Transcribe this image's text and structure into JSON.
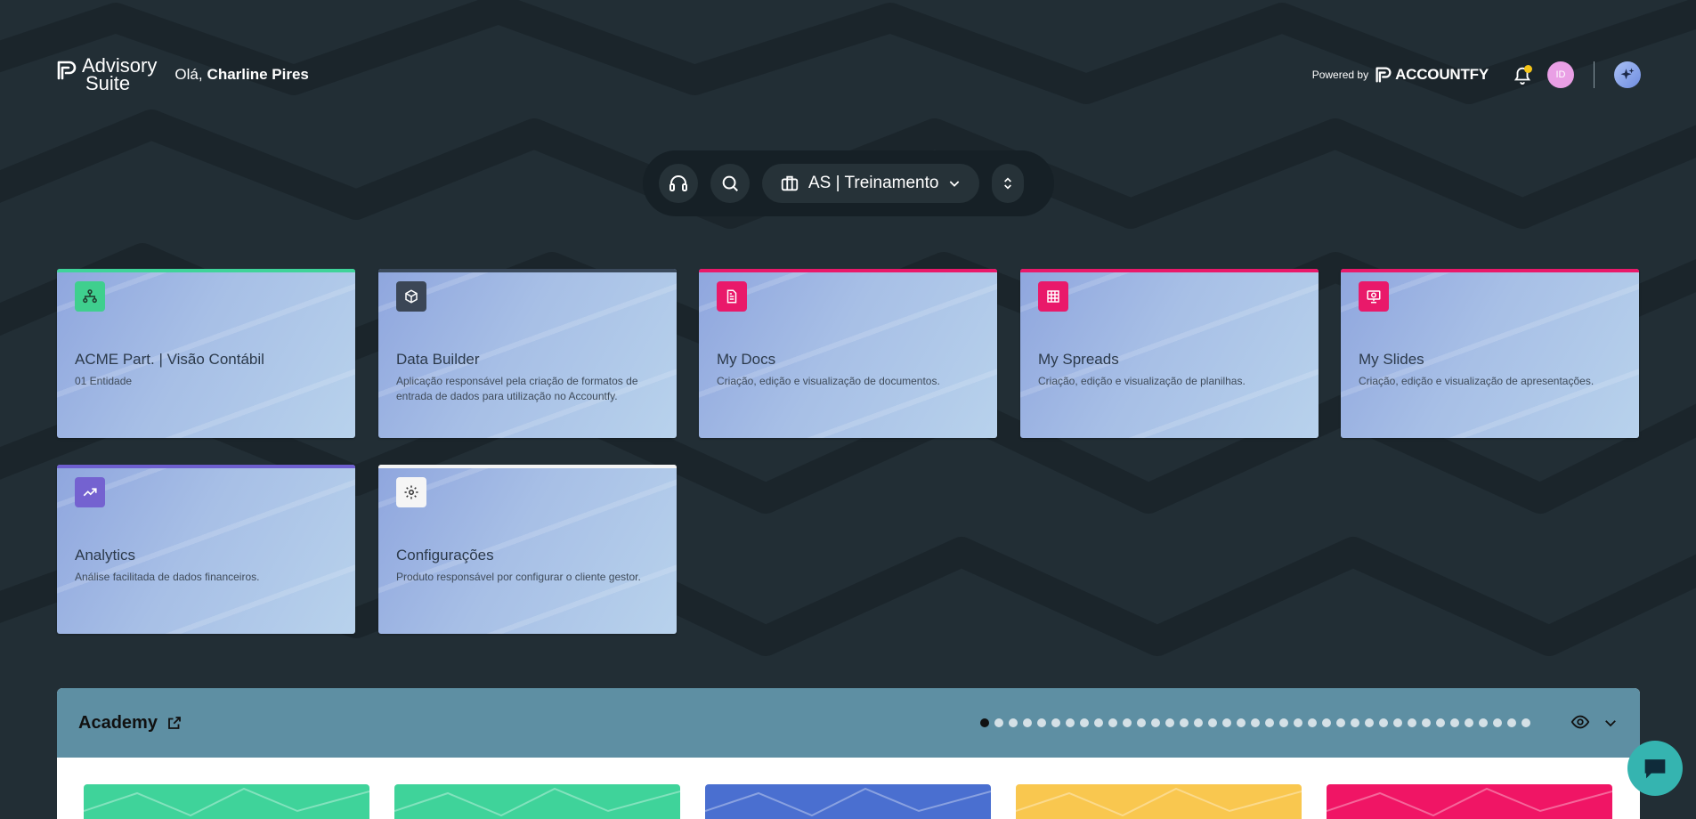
{
  "app": {
    "name_line1": "Advisory",
    "name_line2": "Suite"
  },
  "greeting": {
    "prefix": "Olá,",
    "name": "Charline Pires"
  },
  "header": {
    "powered_by": "Powered by",
    "brand": "ACCOUNTFY",
    "avatar_initials": "ID"
  },
  "toolbar": {
    "workspace": "AS | Treinamento"
  },
  "cards": [
    {
      "title": "ACME Part. | Visão Contábil",
      "desc": "01 Entidade",
      "accent": "#3fd39a",
      "icon": "org-chart-icon",
      "icon_bg": "#3fcf8e"
    },
    {
      "title": "Data Builder",
      "desc": "Aplicação responsável pela criação de formatos de entrada de dados para utilização no Accountfy.",
      "accent": "#3b4a5c",
      "icon": "cube-icon",
      "icon_bg": "#3b4656"
    },
    {
      "title": "My Docs",
      "desc": "Criação, edição e visualização de documentos.",
      "accent": "#e9196a",
      "icon": "document-icon",
      "icon_bg": "#e9196a"
    },
    {
      "title": "My Spreads",
      "desc": "Criação, edição e visualização de planilhas.",
      "accent": "#e9196a",
      "icon": "grid-icon",
      "icon_bg": "#e9196a"
    },
    {
      "title": "My Slides",
      "desc": "Criação, edição e visualização de apresentações.",
      "accent": "#e9196a",
      "icon": "presentation-icon",
      "icon_bg": "#e9196a"
    },
    {
      "title": "Analytics",
      "desc": "Análise facilitada de dados financeiros.",
      "accent": "#6e5fcf",
      "icon": "trend-up-icon",
      "icon_bg": "#7462d0"
    },
    {
      "title": "Configurações",
      "desc": "Produto responsável por configurar o cliente gestor.",
      "accent": "#f4f4f4",
      "icon": "gear-icon",
      "icon_bg": "#f5f5f5"
    }
  ],
  "academy": {
    "title": "Academy",
    "dot_count": 39,
    "active_dot": 0,
    "thumb_colors": [
      "#3fd39a",
      "#3fd39a",
      "#4a6fd0",
      "#f9c74f",
      "#f01565"
    ]
  }
}
